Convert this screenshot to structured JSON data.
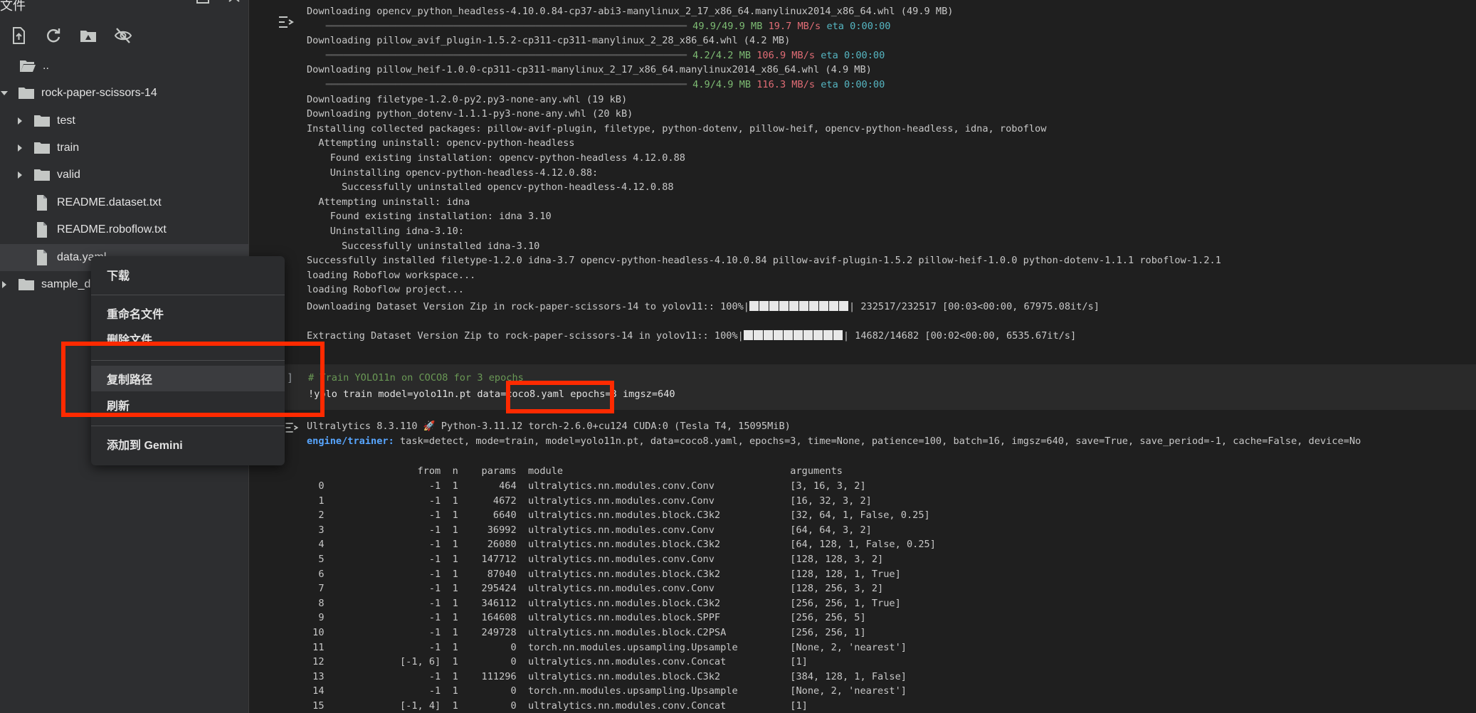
{
  "sidebar": {
    "title": "文件",
    "items": [
      {
        "label": "..",
        "type": "folder-up",
        "indent": 0
      },
      {
        "label": "rock-paper-scissors-14",
        "type": "folder",
        "indent": 0,
        "expanded": true
      },
      {
        "label": "test",
        "type": "folder",
        "indent": 1
      },
      {
        "label": "train",
        "type": "folder",
        "indent": 1
      },
      {
        "label": "valid",
        "type": "folder",
        "indent": 1
      },
      {
        "label": "README.dataset.txt",
        "type": "file",
        "indent": 1
      },
      {
        "label": "README.roboflow.txt",
        "type": "file",
        "indent": 1
      },
      {
        "label": "data.yaml",
        "type": "file",
        "indent": 1,
        "selected": true
      },
      {
        "label": "sample_d",
        "type": "folder",
        "indent": 0
      }
    ]
  },
  "context_menu": {
    "download": "下载",
    "rename": "重命名文件",
    "delete": "删除文件",
    "copy_path": "复制路径",
    "refresh": "刷新",
    "add_gemini": "添加到 Gemini"
  },
  "pip_output": {
    "lines": [
      {
        "text": "Downloading opencv_python_headless-4.10.0.84-cp37-abi3-manylinux_2_17_x86_64.manylinux2014_x86_64.whl (49.9 MB)"
      },
      {
        "bar": true,
        "done": "49.9/49.9 MB",
        "speed": "19.7 MB/s",
        "eta": "eta 0:00:00"
      },
      {
        "text": "Downloading pillow_avif_plugin-1.5.2-cp311-cp311-manylinux_2_28_x86_64.whl (4.2 MB)"
      },
      {
        "bar": true,
        "done": "4.2/4.2 MB",
        "speed": "106.9 MB/s",
        "eta": "eta 0:00:00"
      },
      {
        "text": "Downloading pillow_heif-1.0.0-cp311-cp311-manylinux_2_17_x86_64.manylinux2014_x86_64.whl (4.9 MB)"
      },
      {
        "bar": true,
        "done": "4.9/4.9 MB",
        "speed": "116.3 MB/s",
        "eta": "eta 0:00:00"
      },
      {
        "text": "Downloading filetype-1.2.0-py2.py3-none-any.whl (19 kB)"
      },
      {
        "text": "Downloading python_dotenv-1.1.1-py3-none-any.whl (20 kB)"
      },
      {
        "text": "Installing collected packages: pillow-avif-plugin, filetype, python-dotenv, pillow-heif, opencv-python-headless, idna, roboflow"
      },
      {
        "text": "  Attempting uninstall: opencv-python-headless"
      },
      {
        "text": "    Found existing installation: opencv-python-headless 4.12.0.88"
      },
      {
        "text": "    Uninstalling opencv-python-headless-4.12.0.88:"
      },
      {
        "text": "      Successfully uninstalled opencv-python-headless-4.12.0.88"
      },
      {
        "text": "  Attempting uninstall: idna"
      },
      {
        "text": "    Found existing installation: idna 3.10"
      },
      {
        "text": "    Uninstalling idna-3.10:"
      },
      {
        "text": "      Successfully uninstalled idna-3.10"
      },
      {
        "text": "Successfully installed filetype-1.2.0 idna-3.7 opencv-python-headless-4.10.0.84 pillow-avif-plugin-1.5.2 pillow-heif-1.0.0 python-dotenv-1.1.1 roboflow-1.2.1"
      },
      {
        "text": "loading Roboflow workspace..."
      },
      {
        "text": "loading Roboflow project..."
      }
    ],
    "download_zip": {
      "prefix": "Downloading Dataset Version Zip in rock-paper-scissors-14 to yolov11:: 100%|",
      "suffix": "| 232517/232517 [00:03<00:00, 67975.08it/s]"
    },
    "extract_zip": {
      "prefix": "Extracting Dataset Version Zip to rock-paper-scissors-14 in yolov11:: 100%|",
      "suffix": "| 14682/14682 [00:02<00:00, 6535.67it/s]"
    }
  },
  "code_cell": {
    "bracket": "]",
    "comment": "# Train YOLO11n on COCO8 for 3 epochs",
    "command_a": "!yolo train model=yolo11n.pt ",
    "command_b": "data=coco8.yaml",
    "command_c": " epochs=3 imgsz=640"
  },
  "train_output": {
    "header": "Ultralytics 8.3.110 🚀 Python-3.11.12 torch-2.6.0+cu124 CUDA:0 (Tesla T4, 15095MiB)",
    "trainer_key": "engine/trainer:",
    "trainer_value": " task=detect, mode=train, model=yolo11n.pt, data=coco8.yaml, epochs=3, time=None, patience=100, batch=16, imgsz=640, save=True, save_period=-1, cache=False, device=No",
    "table_header": "                   from  n    params  module                                       arguments",
    "rows": [
      "  0                  -1  1       464  ultralytics.nn.modules.conv.Conv             [3, 16, 3, 2]",
      "  1                  -1  1      4672  ultralytics.nn.modules.conv.Conv             [16, 32, 3, 2]",
      "  2                  -1  1      6640  ultralytics.nn.modules.block.C3k2            [32, 64, 1, False, 0.25]",
      "  3                  -1  1     36992  ultralytics.nn.modules.conv.Conv             [64, 64, 3, 2]",
      "  4                  -1  1     26080  ultralytics.nn.modules.block.C3k2            [64, 128, 1, False, 0.25]",
      "  5                  -1  1    147712  ultralytics.nn.modules.conv.Conv             [128, 128, 3, 2]",
      "  6                  -1  1     87040  ultralytics.nn.modules.block.C3k2            [128, 128, 1, True]",
      "  7                  -1  1    295424  ultralytics.nn.modules.conv.Conv             [128, 256, 3, 2]",
      "  8                  -1  1    346112  ultralytics.nn.modules.block.C3k2            [256, 256, 1, True]",
      "  9                  -1  1    164608  ultralytics.nn.modules.block.SPPF            [256, 256, 5]",
      " 10                  -1  1    249728  ultralytics.nn.modules.block.C2PSA           [256, 256, 1]",
      " 11                  -1  1         0  torch.nn.modules.upsampling.Upsample         [None, 2, 'nearest']",
      " 12             [-1, 6]  1         0  ultralytics.nn.modules.conv.Concat           [1]",
      " 13                  -1  1    111296  ultralytics.nn.modules.block.C3k2            [384, 128, 1, False]",
      " 14                  -1  1         0  torch.nn.modules.upsampling.Upsample         [None, 2, 'nearest']",
      " 15             [-1, 4]  1         0  ultralytics.nn.modules.conv.Concat           [1]"
    ]
  },
  "colors": {
    "highlight": "#ff2a00",
    "accent_blue": "#58a6ff",
    "progress_green": "#7dbb73",
    "speed_red": "#e06c75",
    "eta_cyan": "#56b6c2"
  }
}
